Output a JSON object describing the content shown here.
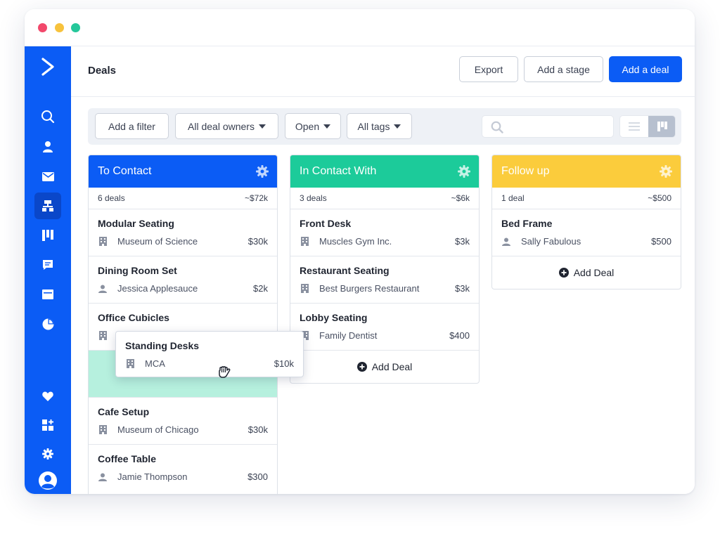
{
  "window": {
    "controls": [
      {
        "name": "close",
        "color": "#f2486b"
      },
      {
        "name": "minimize",
        "color": "#f7c23c"
      },
      {
        "name": "maximize",
        "color": "#25c79a"
      }
    ]
  },
  "colors": {
    "brand": "#0b5cf5",
    "to_contact": "#0b5cf5",
    "in_contact_with": "#1ccb9a",
    "follow_up": "#fbcc3c",
    "drop_slot": "#b6f0de"
  },
  "sidebar": {
    "logo": "chevron-logo-icon",
    "items": [
      {
        "icon": "search-icon",
        "active": false
      },
      {
        "icon": "contacts-icon",
        "active": false
      },
      {
        "icon": "email-icon",
        "active": false
      },
      {
        "icon": "automations-icon",
        "active": true
      },
      {
        "icon": "deals-pipeline-icon",
        "active": false
      },
      {
        "icon": "conversations-icon",
        "active": false
      },
      {
        "icon": "site-icon",
        "active": false
      },
      {
        "icon": "reports-icon",
        "active": false
      }
    ],
    "bottom": [
      {
        "icon": "heart-icon"
      },
      {
        "icon": "apps-icon"
      },
      {
        "icon": "gear-icon"
      },
      {
        "icon": "user-avatar-icon"
      }
    ]
  },
  "header": {
    "title": "Deals",
    "export_label": "Export",
    "add_stage_label": "Add a stage",
    "add_deal_label": "Add a deal"
  },
  "filters": {
    "add_filter": "Add a filter",
    "owners": "All deal owners",
    "status": "Open",
    "tags": "All tags",
    "search_placeholder": ""
  },
  "stages": [
    {
      "title": "To Contact",
      "count": "6 deals",
      "total": "~$72k",
      "deals": [
        {
          "title": "Modular Seating",
          "owner": "Museum of Science",
          "owner_type": "building-icon",
          "amount": "$30k"
        },
        {
          "title": "Dining Room Set",
          "owner": "Jessica Applesauce",
          "owner_type": "person-icon",
          "amount": "$2k"
        },
        {
          "title": "Office Cubicles",
          "owner": "",
          "owner_type": "building-icon",
          "amount": ""
        },
        {
          "title": "Cafe Setup",
          "owner": "Museum of Chicago",
          "owner_type": "building-icon",
          "amount": "$30k"
        },
        {
          "title": "Coffee Table",
          "owner": "Jamie Thompson",
          "owner_type": "person-icon",
          "amount": "$300"
        }
      ]
    },
    {
      "title": "In Contact With",
      "count": "3 deals",
      "total": "~$6k",
      "deals": [
        {
          "title": "Front Desk",
          "owner": "Muscles Gym Inc.",
          "owner_type": "building-icon",
          "amount": "$3k"
        },
        {
          "title": "Restaurant Seating",
          "owner": "Best Burgers Restaurant",
          "owner_type": "building-icon",
          "amount": "$3k"
        },
        {
          "title": "Lobby Seating",
          "owner": "Family Dentist",
          "owner_type": "building-icon",
          "amount": "$400"
        }
      ],
      "add_label": "Add Deal"
    },
    {
      "title": "Follow up",
      "count": "1 deal",
      "total": "~$500",
      "deals": [
        {
          "title": "Bed Frame",
          "owner": "Sally Fabulous",
          "owner_type": "person-icon",
          "amount": "$500"
        }
      ],
      "add_label": "Add Deal"
    }
  ],
  "dragging": {
    "title": "Standing Desks",
    "owner": "MCA",
    "owner_type": "building-icon",
    "amount": "$10k",
    "cursor": "grab-hand-icon"
  }
}
